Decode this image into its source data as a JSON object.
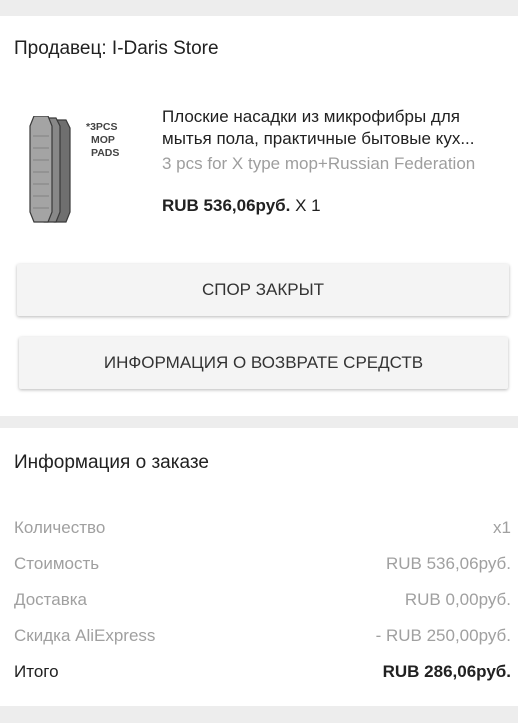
{
  "seller": {
    "title": "Продавец: I-Daris Store"
  },
  "product": {
    "image_icon": "mop-pads-image",
    "image_text_lines": [
      "*3PCS",
      "MOP",
      "PADS"
    ],
    "name_line1": "Плоские насадки из микрофибры для",
    "name_line2": "мытья пола, практичные бытовые кух...",
    "variant": "3 pcs for X type mop+Russian Federation",
    "price": "RUB 536,06руб.",
    "quantity": "X 1"
  },
  "actions": {
    "dispute_label": "Спор закрыт",
    "refund_label": "Информация о возврате средств"
  },
  "order": {
    "title": "Информация о заказе",
    "rows": [
      {
        "label": "Количество",
        "value": "x1"
      },
      {
        "label": "Стоимость",
        "value": "RUB 536,06руб."
      },
      {
        "label": "Доставка",
        "value": "RUB 0,00руб."
      },
      {
        "label": "Скидка AliExpress",
        "value": "- RUB 250,00руб."
      },
      {
        "label": "Итого",
        "value": "RUB 286,06руб."
      }
    ]
  },
  "colors": {
    "background": "#ededed",
    "card": "#ffffff",
    "text_primary": "#212121",
    "text_secondary": "#9e9e9e",
    "button": "#f4f4f4"
  }
}
